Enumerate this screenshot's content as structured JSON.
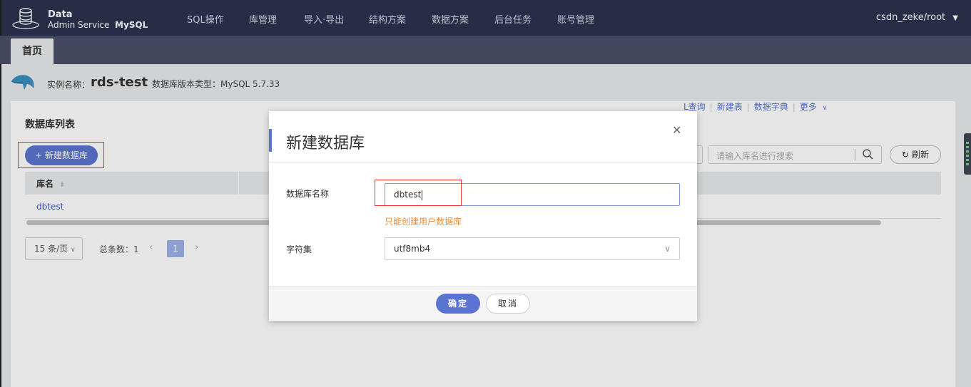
{
  "brand": {
    "line1": "Data",
    "line2": "Admin Service",
    "line3": "MySQL"
  },
  "nav": [
    "SQL操作",
    "库管理",
    "导入·导出",
    "结构方案",
    "数据方案",
    "后台任务",
    "账号管理"
  ],
  "user": {
    "name": "csdn_zeke/root",
    "caret": "▼"
  },
  "tabs": {
    "home": "首页"
  },
  "instance": {
    "label": "实例名称：",
    "name": "rds-test",
    "version": "数据库版本类型：MySQL 5.7.33"
  },
  "list": {
    "title": "数据库列表",
    "new_button": "+ 新建数据库",
    "search_placeholder": "请输入库名进行搜索",
    "refresh": "刷新",
    "column_name": "库名",
    "rows": [
      {
        "name": "dbtest"
      }
    ],
    "row_actions": [
      "L查询",
      "新建表",
      "数据字典",
      "更多"
    ],
    "page_size": "15 条/页",
    "total": "总条数：1",
    "current_page": "1"
  },
  "modal": {
    "title": "新建数据库",
    "db_name_label": "数据库名称",
    "db_name_value": "dbtest",
    "hint": "只能创建用户数据库",
    "charset_label": "字符集",
    "charset_value": "utf8mb4",
    "ok": "确定",
    "cancel": "取消"
  }
}
